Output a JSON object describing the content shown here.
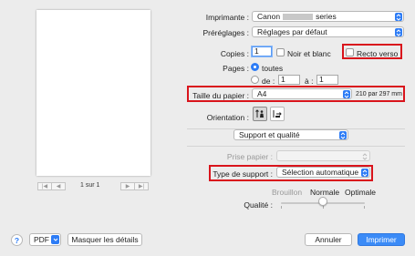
{
  "preview": {
    "page_counter": "1 sur 1",
    "first": "|◀",
    "prev": "◀",
    "next": "▶",
    "last": "▶|"
  },
  "printer": {
    "label": "Imprimante :",
    "value_prefix": "Canon",
    "value_suffix": "series"
  },
  "presets": {
    "label": "Préréglages :",
    "value": "Réglages par défaut"
  },
  "copies": {
    "label": "Copies :",
    "value": "1",
    "bw_label": "Noir et blanc",
    "duplex_label": "Recto verso"
  },
  "pages": {
    "label": "Pages :",
    "all_label": "toutes",
    "from_label": "de :",
    "from_value": "1",
    "to_label": "à :",
    "to_value": "1"
  },
  "paper_size": {
    "label": "Taille du papier :",
    "value": "A4",
    "dims": "210 par 297 mm"
  },
  "orientation": {
    "label": "Orientation :"
  },
  "section": {
    "value": "Support et qualité"
  },
  "paper_source": {
    "label": "Prise papier :",
    "value": ""
  },
  "media_type": {
    "label": "Type de support :",
    "value": "Sélection automatique"
  },
  "quality": {
    "label": "Qualité :",
    "draft": "Brouillon",
    "normal": "Normale",
    "best": "Optimale",
    "level": 0.5
  },
  "footer": {
    "help": "?",
    "pdf": "PDF",
    "hide_details": "Masquer les détails",
    "cancel": "Annuler",
    "print": "Imprimer"
  },
  "colors": {
    "accent": "#2d7cf6",
    "highlight": "#d9141c"
  }
}
